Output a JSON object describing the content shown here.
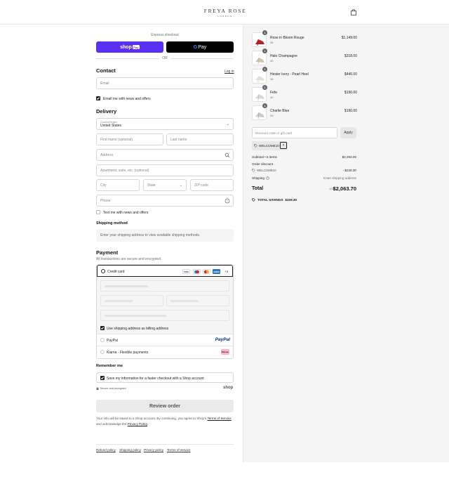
{
  "header": {
    "brand": "FREYA ROSE",
    "brand_sub": "LONDON",
    "cart_icon": "shopping-bag-icon"
  },
  "express": {
    "label": "Express checkout",
    "shop_pay": "shop",
    "shop_pay_badge": "Pay",
    "gpay_g": "G",
    "gpay": "Pay",
    "or": "OR"
  },
  "contact": {
    "title": "Contact",
    "login": "Log in",
    "email_placeholder": "Email",
    "news_label": "Email me with news and offers",
    "news_checked": true
  },
  "delivery": {
    "title": "Delivery",
    "country_label": "Country/Region",
    "country_value": "United States",
    "first_name": "First name (optional)",
    "last_name": "Last name",
    "address": "Address",
    "apartment": "Apartment, suite, etc. (optional)",
    "city": "City",
    "state": "State",
    "zip": "ZIP code",
    "phone": "Phone",
    "sms_label": "Text me with news and offers",
    "sms_checked": false
  },
  "shipping_method": {
    "title": "Shipping method",
    "message": "Enter your shipping address to view available shipping methods."
  },
  "payment": {
    "title": "Payment",
    "subtitle": "All transactions are secure and encrypted.",
    "credit_card": "Credit card",
    "more_cards": "+4",
    "billing_label": "Use shipping address as billing address",
    "billing_checked": true,
    "paypal": "PayPal",
    "paypal_logo": "PayPal",
    "klarna": "Klarna - Flexible payments",
    "klarna_logo": "Klarna.",
    "cards": [
      {
        "name": "visa",
        "label": "VISA",
        "color": "#1a1f71"
      },
      {
        "name": "maestro",
        "label": "",
        "color": "#0099df"
      },
      {
        "name": "mastercard",
        "label": "",
        "color": "#eb001b"
      },
      {
        "name": "amex",
        "label": "AMEX",
        "color": "#2e77bc"
      }
    ]
  },
  "remember": {
    "title": "Remember me",
    "label": "Save my information for a faster checkout with a Shop account",
    "checked": true,
    "secure": "Secure and encrypted",
    "shop_logo": "shop"
  },
  "review_button": "Review order",
  "footnote": {
    "text1": "Your info will be saved to a Shop account. By continuing, you agree to Shop's ",
    "terms": "Terms of Service",
    "text2": " and acknowledge the ",
    "privacy": "Privacy Policy",
    "text3": "."
  },
  "footer_links": [
    "Refund policy",
    "Shipping policy",
    "Privacy policy",
    "Terms of service"
  ],
  "cart": {
    "items": [
      {
        "name": "Rose in Bloom Rouge",
        "size": "35",
        "price": "$1,149.00",
        "qty": "1",
        "color": "#b81d22"
      },
      {
        "name": "Halo Champagne",
        "size": "40",
        "price": "$318.00",
        "qty": "1",
        "color": "#cfc6b0"
      },
      {
        "name": "Hester Ivory - Pearl Heel",
        "size": "36",
        "price": "$446.00",
        "qty": "1",
        "color": "#e4e0d2"
      },
      {
        "name": "Fefe",
        "size": "40",
        "price": "$190.00",
        "qty": "1",
        "color": "#d8d8d8"
      },
      {
        "name": "Charlie Blue",
        "size": "39",
        "price": "$190.00",
        "qty": "1",
        "color": "#c7ccd1"
      }
    ],
    "discount_placeholder": "Discount code or gift card",
    "apply": "Apply",
    "applied_code": "WELCOME10",
    "subtotal_label": "Subtotal • 5 items",
    "subtotal": "$2,293.00",
    "order_discount_label": "Order discount",
    "discount_code": "WELCOME10",
    "discount_value": "- $229.30",
    "shipping_label": "Shipping",
    "shipping_value": "Enter shipping address",
    "total_label": "Total",
    "currency": "USD",
    "total": "$2,063.70",
    "savings_label": "TOTAL SAVINGS",
    "savings": "$229.30"
  }
}
